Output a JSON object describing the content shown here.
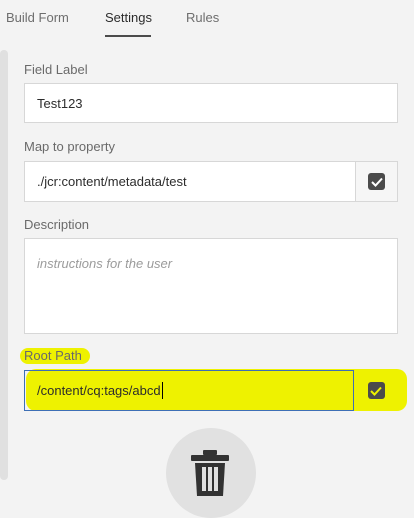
{
  "tabs": [
    {
      "label": "Build Form"
    },
    {
      "label": "Settings"
    },
    {
      "label": "Rules"
    }
  ],
  "fields": {
    "field_label": {
      "label": "Field Label",
      "value": "Test123"
    },
    "map_to_property": {
      "label": "Map to property",
      "value": "./jcr:content/metadata/test",
      "checked": true
    },
    "description": {
      "label": "Description",
      "placeholder": "instructions for the user"
    },
    "root_path": {
      "label": "Root Path",
      "value": "/content/cq:tags/abcd",
      "checked": true
    }
  },
  "icons": {
    "check": "checkmark-icon",
    "delete": "trash-icon"
  },
  "colors": {
    "highlight": "#eef200",
    "accent": "#4b4b4b"
  }
}
